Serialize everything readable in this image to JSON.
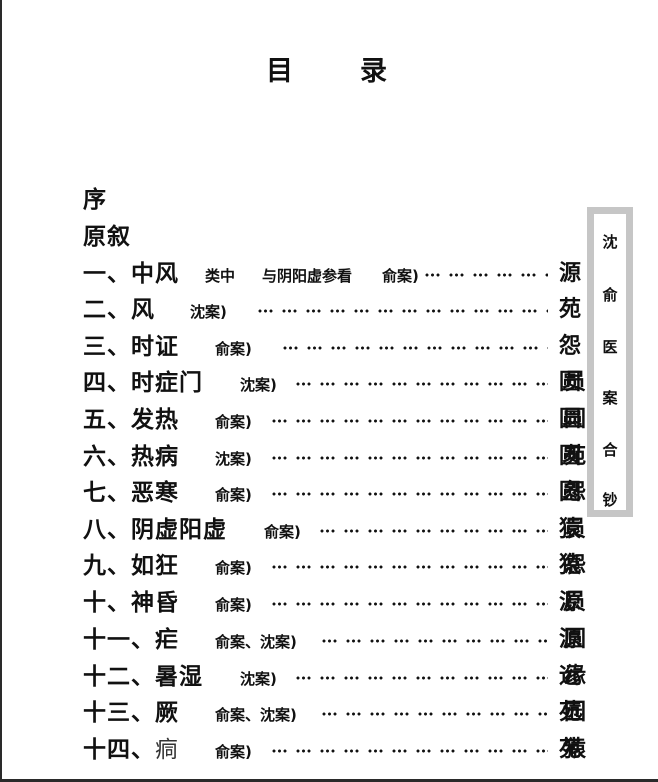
{
  "title": {
    "chars": [
      "目",
      "录"
    ]
  },
  "entries": [
    {
      "label": "序"
    },
    {
      "label": "原叙"
    },
    {
      "num": "一、",
      "title": "中风",
      "notes": [
        "类中",
        "与阴阳虚参看",
        "俞案)"
      ],
      "page": [
        "源"
      ]
    },
    {
      "num": "二、",
      "title": "风",
      "notes": [
        "沈案)"
      ],
      "page": [
        "苑"
      ]
    },
    {
      "num": "三、",
      "title": "时证",
      "notes": [
        "俞案)"
      ],
      "page": [
        "怨"
      ]
    },
    {
      "num": "四、",
      "title": "时症门",
      "notes": [
        "沈案)"
      ],
      "page": [
        "圆",
        "员"
      ]
    },
    {
      "num": "五、",
      "title": "发热",
      "notes": [
        "俞案)"
      ],
      "page": [
        "圆",
        "圆"
      ]
    },
    {
      "num": "六、",
      "title": "热病",
      "notes": [
        "沈案)"
      ],
      "page": [
        "圆",
        "苑"
      ]
    },
    {
      "num": "七、",
      "title": "恶寒",
      "notes": [
        "俞案)"
      ],
      "page": [
        "圆",
        "怨"
      ]
    },
    {
      "num": "八、",
      "title": "阴虚阳虚",
      "notes": [
        "俞案)"
      ],
      "page": [
        "猿",
        "员"
      ]
    },
    {
      "num": "九、",
      "title": "如狂",
      "notes": [
        "俞案)"
      ],
      "page": [
        "猿",
        "怨"
      ]
    },
    {
      "num": "十、",
      "title": "神昏",
      "notes": [
        "俞案)"
      ],
      "page": [
        "源",
        "员"
      ]
    },
    {
      "num": "十一、",
      "title": "疟",
      "notes": [
        "俞案、沈案)"
      ],
      "page": [
        "源",
        "圆"
      ]
    },
    {
      "num": "十二、",
      "title": "暑湿",
      "notes": [
        "沈案)"
      ],
      "page": [
        "远",
        "缘"
      ]
    },
    {
      "num": "十三、",
      "title": "厥",
      "notes": [
        "俞案、沈案)"
      ],
      "page": [
        "苑",
        "园"
      ]
    },
    {
      "num": "十四、",
      "title": "痌",
      "notes": [
        "俞案)"
      ],
      "page": [
        "苑",
        "猿"
      ]
    }
  ],
  "side_label": [
    "沈",
    "俞",
    "医",
    "案",
    "合",
    "钞"
  ]
}
